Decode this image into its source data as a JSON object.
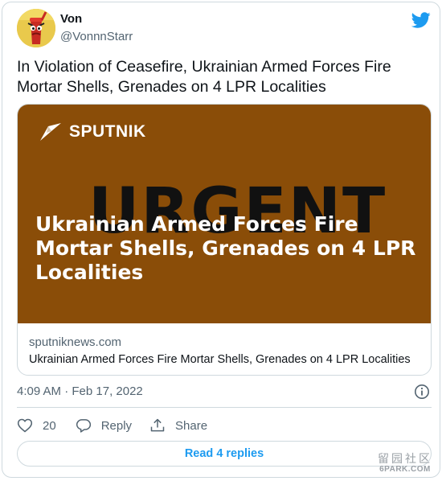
{
  "author": {
    "name": "Von",
    "handle": "@VonnnStarr"
  },
  "tweet": {
    "text": "In Violation of Ceasefire, Ukrainian Armed Forces Fire Mortar Shells, Grenades on 4 LPR Localities",
    "timestamp": "4:09 AM · Feb 17, 2022"
  },
  "link_card": {
    "brand": "SPUTNIK",
    "image_big_word": "URGENT",
    "image_headline": "Ukrainian Armed Forces Fire Mortar Shells, Grenades on 4 LPR Localities",
    "domain": "sputniknews.com",
    "title": "Ukrainian Armed Forces Fire Mortar Shells, Grenades on 4 LPR Localities",
    "image_background": "#8a4d08"
  },
  "actions": {
    "like_count": "20",
    "reply_label": "Reply",
    "share_label": "Share",
    "read_replies_label": "Read 4 replies"
  },
  "icons": [
    "twitter-bird-icon",
    "info-icon",
    "heart-icon",
    "reply-bubble-icon",
    "share-icon",
    "sputnik-logo-icon"
  ],
  "colors": {
    "accent": "#1d9bf0",
    "text_secondary": "#536471",
    "border": "#cfd9de"
  },
  "watermark": {
    "cn": "留园社区",
    "en": "6PARK.COM"
  }
}
